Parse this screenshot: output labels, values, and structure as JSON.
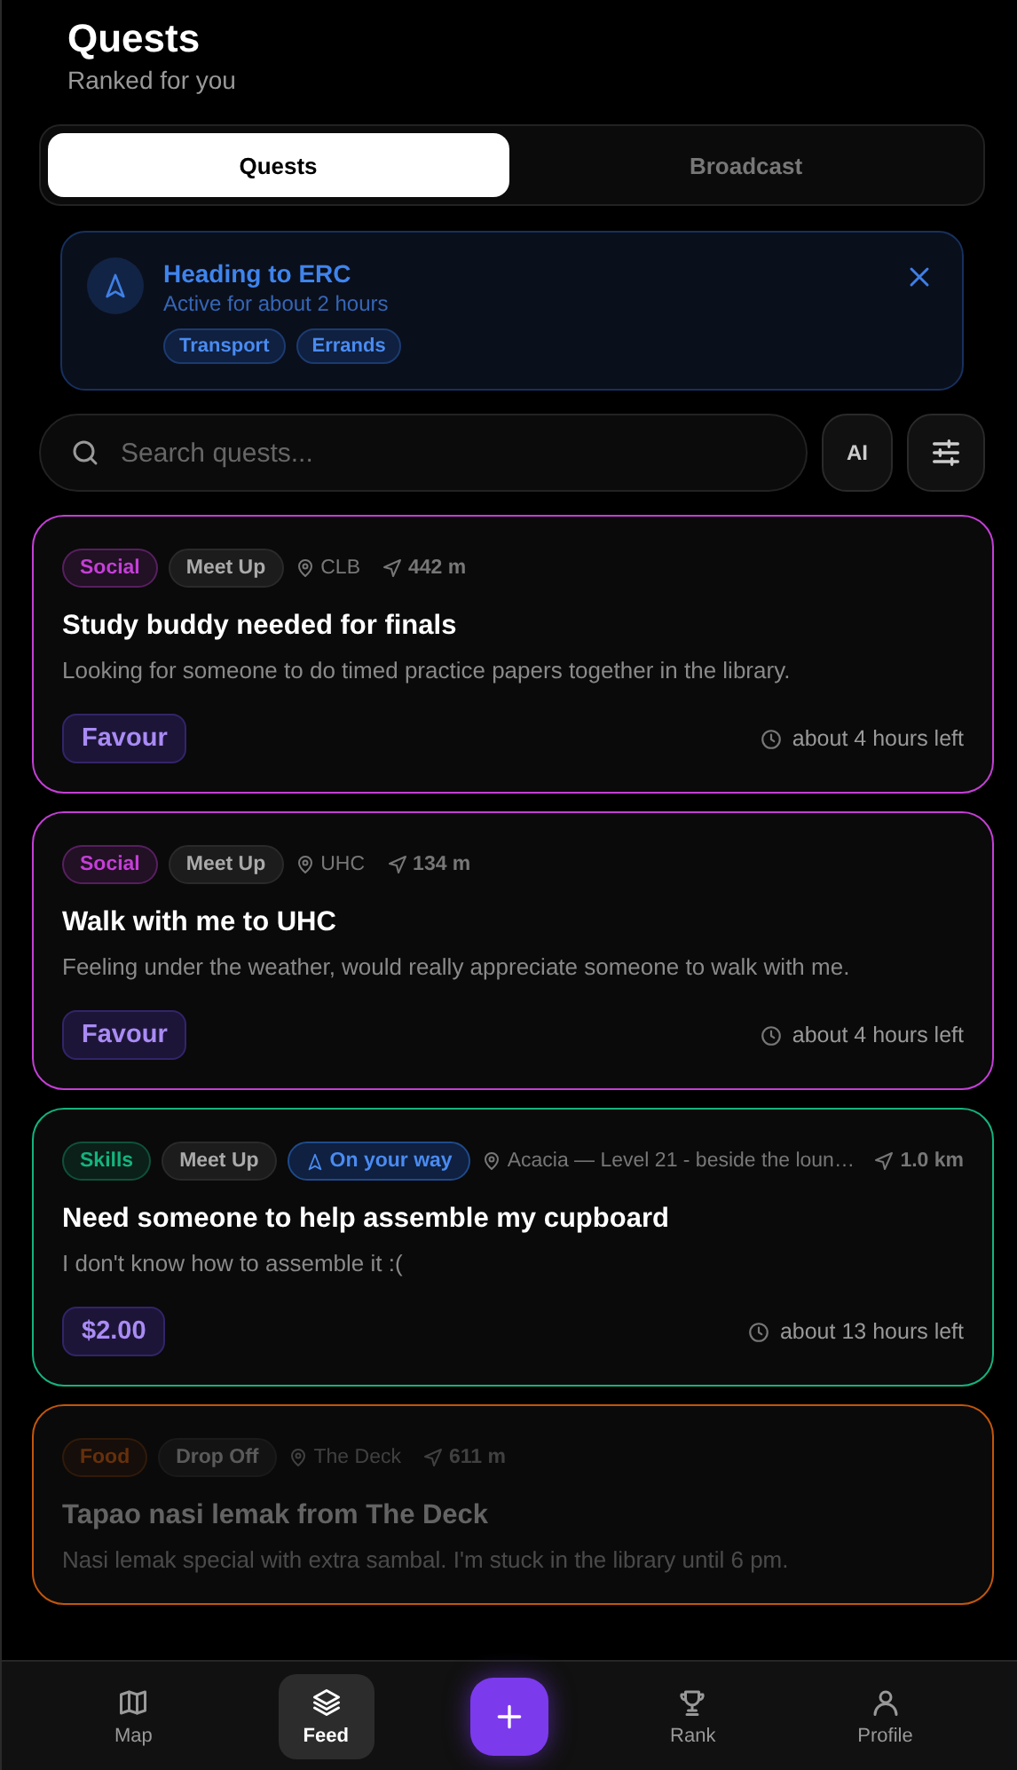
{
  "header": {
    "title": "Quests",
    "subtitle": "Ranked for you"
  },
  "tabs": [
    {
      "label": "Quests",
      "selected": true
    },
    {
      "label": "Broadcast",
      "selected": false
    }
  ],
  "banner": {
    "title": "Heading to ERC",
    "subtitle": "Active for about 2 hours",
    "tags": [
      "Transport",
      "Errands"
    ]
  },
  "search": {
    "placeholder": "Search quests...",
    "ai_button": "AI"
  },
  "quests": [
    {
      "color": "#c43fd6",
      "dimmed": false,
      "tags": [
        {
          "kind": "category",
          "label": "Social"
        },
        {
          "kind": "type",
          "label": "Meet Up"
        }
      ],
      "location": "CLB",
      "distance": "442 m",
      "title": "Study buddy needed for finals",
      "description": "Looking for someone to do timed practice papers together in the library.",
      "reward": "Favour",
      "time_left": "about 4 hours left"
    },
    {
      "color": "#c43fd6",
      "dimmed": false,
      "tags": [
        {
          "kind": "category",
          "label": "Social"
        },
        {
          "kind": "type",
          "label": "Meet Up"
        }
      ],
      "location": "UHC",
      "distance": "134 m",
      "title": "Walk with me to UHC",
      "description": "Feeling under the weather, would really appreciate someone to walk with me.",
      "reward": "Favour",
      "time_left": "about 4 hours left"
    },
    {
      "color": "#14b37d",
      "dimmed": false,
      "tags": [
        {
          "kind": "category",
          "label": "Skills"
        },
        {
          "kind": "type",
          "label": "Meet Up"
        },
        {
          "kind": "status",
          "label": "On your way"
        }
      ],
      "location": "Acacia — Level 21 - beside the loun…",
      "distance": "1.0 km",
      "title": "Need someone to help assemble my cupboard",
      "description": "I don't know how to assemble it :(",
      "reward": "$2.00",
      "time_left": "about 13 hours left"
    },
    {
      "color": "#c2560c",
      "dimmed": true,
      "tags": [
        {
          "kind": "category",
          "label": "Food"
        },
        {
          "kind": "type",
          "label": "Drop Off"
        }
      ],
      "location": "The Deck",
      "distance": "611 m",
      "title": "Tapao nasi lemak from The Deck",
      "description": "Nasi lemak special with extra sambal. I'm stuck in the library until 6 pm."
    }
  ],
  "nav": [
    {
      "kind": "map",
      "label": "Map",
      "selected": false
    },
    {
      "kind": "feed",
      "label": "Feed",
      "selected": true
    },
    {
      "kind": "create"
    },
    {
      "kind": "rank",
      "label": "Rank",
      "selected": false
    },
    {
      "kind": "profile",
      "label": "Profile",
      "selected": false
    }
  ]
}
